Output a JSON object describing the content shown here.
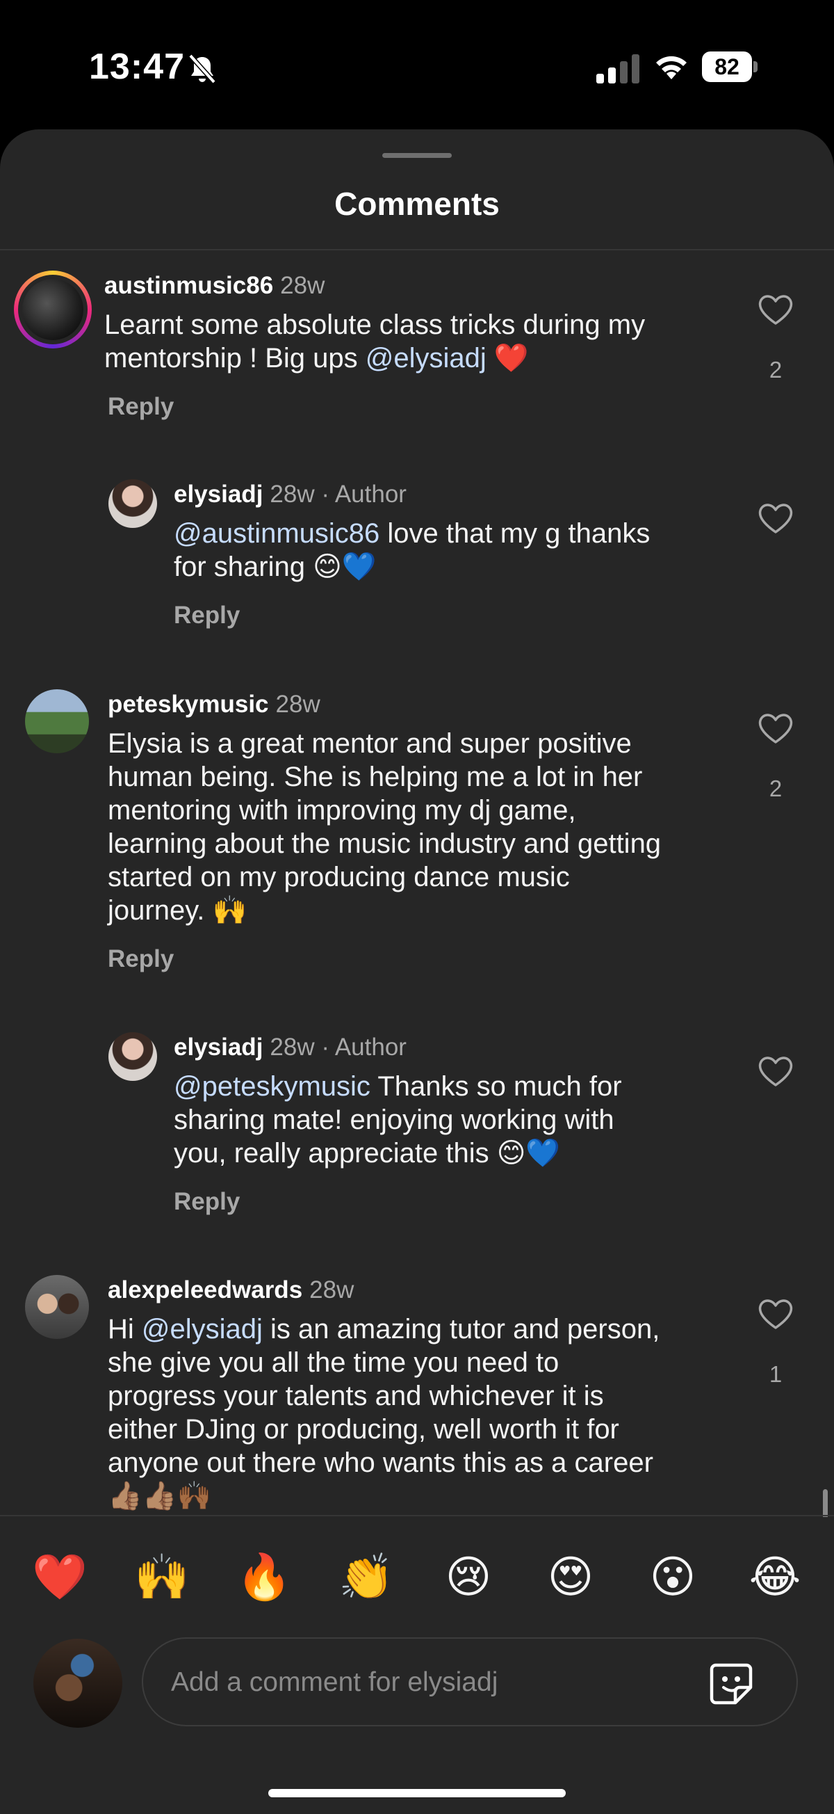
{
  "status_bar": {
    "time": "13:47",
    "battery": "82"
  },
  "sheet": {
    "title": "Comments"
  },
  "comments": [
    {
      "username": "austinmusic86",
      "age": "28w",
      "tag": "",
      "text_parts": [
        "Learnt some absolute class tricks during my",
        "mentorship ! Big ups ",
        "@elysiadj",
        " ❤️"
      ],
      "reply": "Reply",
      "likes": "2"
    },
    {
      "username": "elysiadj",
      "age": "28w",
      "tag": "· Author",
      "text_parts": [
        "@austinmusic86",
        " love that my g thanks",
        "for sharing 😊💙"
      ],
      "reply": "Reply",
      "likes": ""
    },
    {
      "username": "peteskymusic",
      "age": "28w",
      "tag": "",
      "text_lines": [
        "Elysia is a great mentor and super positive",
        "human being.  She is helping me a lot in her",
        "mentoring with improving my dj game,",
        "learning about the music industry and getting",
        "started on my producing dance music",
        "journey. 🙌"
      ],
      "reply": "Reply",
      "likes": "2"
    },
    {
      "username": "elysiadj",
      "age": "28w",
      "tag": "· Author",
      "text_parts": [
        "@peteskymusic",
        " Thanks so much for",
        "sharing mate! enjoying working with",
        "you, really appreciate this 😊💙"
      ],
      "reply": "Reply",
      "likes": ""
    },
    {
      "username": "alexpeleedwards",
      "age": "28w",
      "tag": "",
      "text_parts": [
        "Hi ",
        "@elysiadj",
        " is an amazing tutor and person,",
        "she give you all the time you need to",
        "progress your talents and whichever it is",
        "either DJing or producing, well worth it for",
        "anyone out there who wants this as a career",
        "👍🏽👍🏽🙌🏾"
      ],
      "reply": "",
      "likes": "1"
    }
  ],
  "emoji_bar": [
    "❤️",
    "🙌",
    "🔥",
    "👏",
    "😢",
    "😍",
    "😮",
    "😂"
  ],
  "composer": {
    "placeholder": "Add a comment for elysiadj"
  }
}
